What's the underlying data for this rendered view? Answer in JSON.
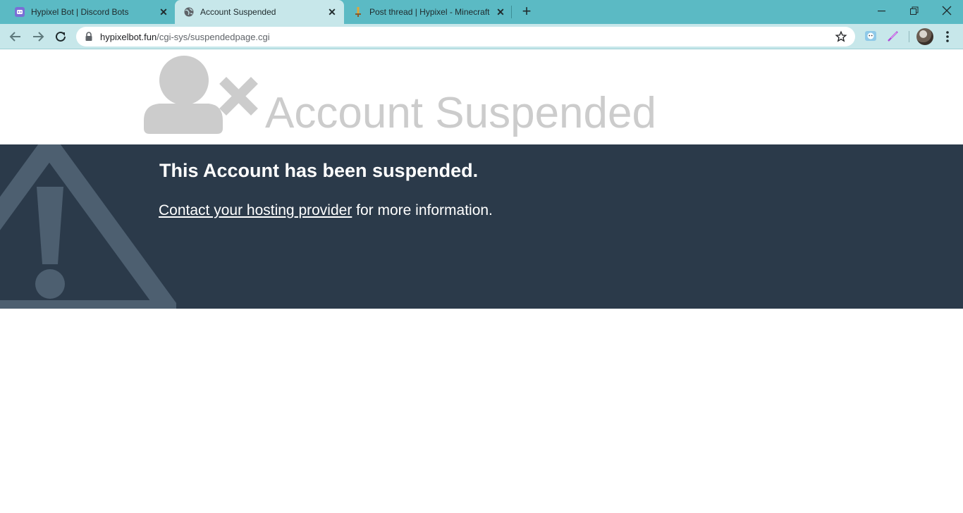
{
  "browser": {
    "tabs": [
      {
        "title": "Hypixel Bot | Discord Bots",
        "favicon": "discord-bots-icon"
      },
      {
        "title": "Account Suspended",
        "favicon": "globe-icon",
        "active": true
      },
      {
        "title": "Post thread | Hypixel - Minecraft",
        "favicon": "hypixel-sword-icon"
      }
    ],
    "address": {
      "host": "hypixelbot.fun",
      "path": "/cgi-sys/suspendedpage.cgi"
    },
    "accent_color": "#5bbac4",
    "toolbar_color": "#c7e7ea"
  },
  "page": {
    "title": "Account Suspended",
    "heading": "This Account has been suspended.",
    "link_text": "Contact your hosting provider",
    "trailing_text": " for more information.",
    "banner_color": "#2b3a4a",
    "icon_color": "#cccccc",
    "warning_icon_color": "#4d5f70"
  }
}
